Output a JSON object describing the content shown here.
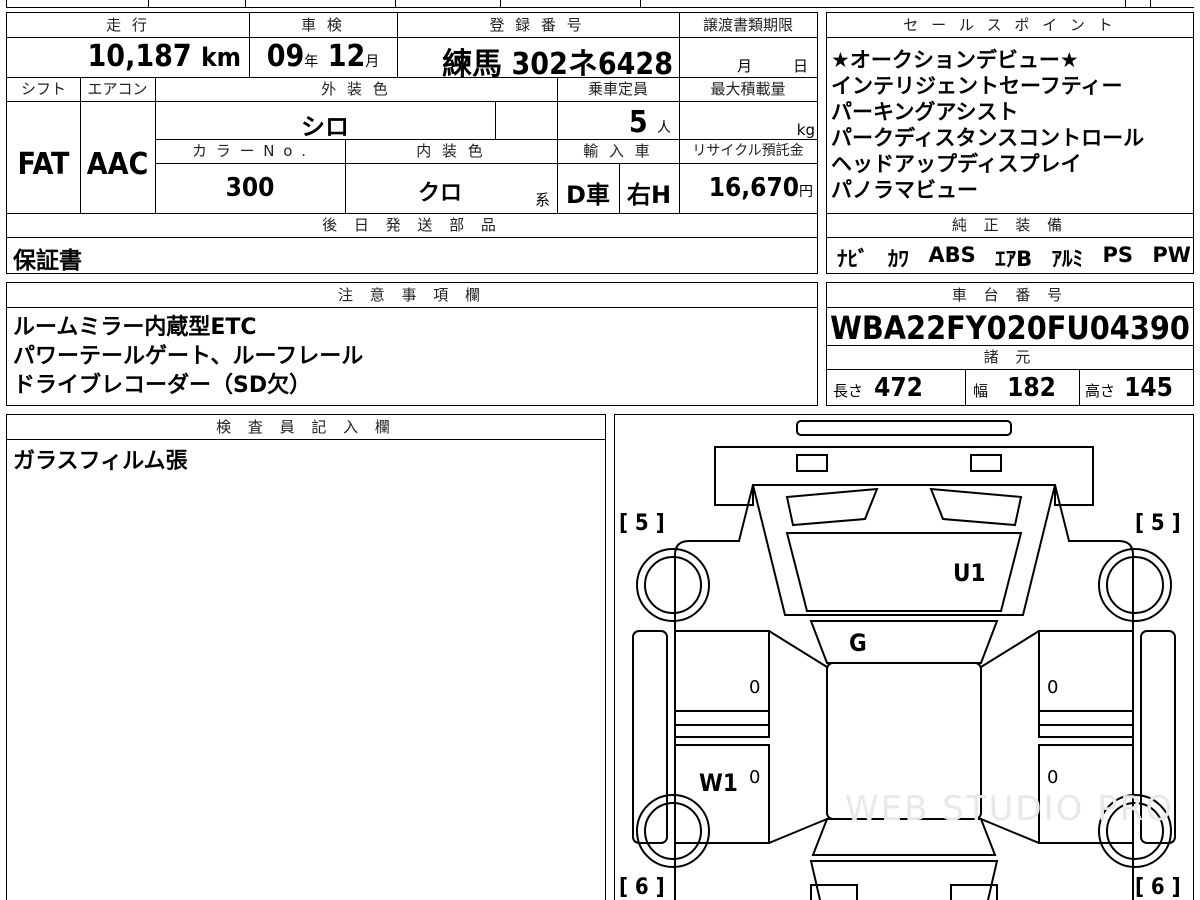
{
  "header_labels": {
    "mileage": "走 行",
    "inspection": "車 検",
    "plate": "登 録 番 号",
    "transfer_deadline": "譲渡書類期限",
    "shift": "シフト",
    "aircon": "エアコン",
    "exterior_color": "外 装 色",
    "capacity": "乗車定員",
    "max_load": "最大積載量",
    "color_no": "カ ラ ー N o .",
    "interior_color": "内 装 色",
    "import": "輸 入 車",
    "recycle_fee": "リサイクル預託金",
    "later_parts": "後 日 発 送 部 品",
    "notes": "注 意 事 項 欄",
    "inspector": "検 査 員 記 入 欄",
    "sales_points": "セ ー ル ス ポ イ ン ト",
    "equipment": "純 正 装 備",
    "vin": "車 台 番 号",
    "specs": "諸 元"
  },
  "vehicle": {
    "mileage_value": "10,187",
    "mileage_unit": "km",
    "inspection_year": "09",
    "year_unit": "年",
    "inspection_month": "12",
    "month_unit": "月",
    "plate_region": "練馬",
    "plate_number": "302ネ6428",
    "deadline_month": "月",
    "deadline_day": "日",
    "shift": "FAT",
    "aircon": "AAC",
    "exterior_color": "シロ",
    "capacity": "5",
    "capacity_unit": "人",
    "load_unit": "kg",
    "color_no": "300",
    "interior_color": "クロ",
    "interior_suffix": "系",
    "import_dealer": "D車",
    "import_handle": "右H",
    "recycle_fee": "16,670",
    "recycle_unit": "円"
  },
  "later_parts": "保証書",
  "notes": [
    "ルームミラー内蔵型ETC",
    "パワーテールゲート、ルーフレール",
    "ドライブレコーダー（SD欠）"
  ],
  "inspector_notes": "ガラスフィルム張",
  "sales_points": [
    "★オークションデビュー★",
    "インテリジェントセーフティー",
    "パーキングアシスト",
    "パークディスタンスコントロール",
    "ヘッドアップディスプレイ",
    "パノラマビュー"
  ],
  "equipment": [
    "ﾅﾋﾞ",
    "ｶﾜ",
    "ABS",
    "ｴｱB",
    "ｱﾙﾐ",
    "PS",
    "PW"
  ],
  "vin": "WBA22FY020FU04390",
  "specs": {
    "length_label": "長さ",
    "length": "472",
    "width_label": "幅",
    "width": "182",
    "height_label": "高さ",
    "height": "145"
  },
  "diagram": {
    "tire_front_left": "[ 5 ]",
    "tire_front_right": "[ 5 ]",
    "tire_rear_left": "[ 6 ]",
    "tire_rear_right": "[ 6 ]",
    "mark_roof": "U1",
    "mark_glass": "G",
    "mark_side": "W1",
    "door_marks": [
      "0",
      "0",
      "0",
      "0"
    ],
    "watermark": "WEB STUDIO PRO"
  }
}
